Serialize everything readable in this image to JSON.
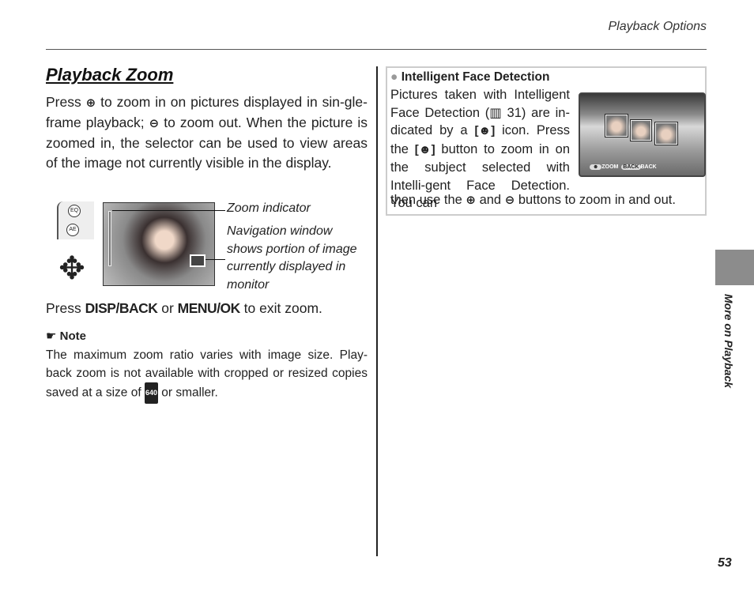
{
  "header": {
    "section": "Playback Options"
  },
  "main": {
    "title": "Playback Zoom",
    "intro": [
      "Press ",
      "zoom-in-icon",
      " to zoom in on pictures displayed in single-frame playback; ",
      "zoom-out-icon",
      " to zoom out.  When the picture is zoomed in, the selector can be used to view areas of the image not currently visible in the display."
    ],
    "intro_a": "Press ",
    "intro_b": " to zoom in on pictures displayed in sin-gle-frame playback; ",
    "intro_c": " to zoom out.  When the picture is zoomed in, the selector can be used to view areas of the image not currently visible in the display.",
    "figure": {
      "callout_zoom": "Zoom indicator",
      "callout_nav": "Navigation window shows portion of image currently displayed in monitor",
      "btn1": "EQ",
      "btn2": "AE"
    },
    "exit": {
      "a": "Press ",
      "disp": "DISP/BACK",
      "or": " or ",
      "menu": "MENU/OK",
      "b": " to exit zoom."
    },
    "note": {
      "heading": "Note",
      "text_a": "The maximum zoom ratio varies with image size.  Play-back zoom is not available with cropped or resized copies saved at a size of ",
      "size_icon": "640",
      "text_b": " or smaller."
    }
  },
  "tip": {
    "heading": "Intelligent Face Detection",
    "t1": "Pictures taken with Intelligent Face Detection (",
    "ref": "31",
    "t2": ") are in-dicated by a ",
    "t3": " icon.  Press the ",
    "t4": " button to zoom in on the subject selected with Intelli-gent Face Detection.  You can",
    "t5": "then use the ",
    "t6": " and ",
    "t7": " buttons to zoom in and out.",
    "screen": {
      "zoom": "ZOOM",
      "back_btn": "BACK",
      "back": "BACK"
    }
  },
  "sidebar": {
    "label": "More on Playback",
    "page": "53",
    "tab_color": "#8c8c8c"
  }
}
